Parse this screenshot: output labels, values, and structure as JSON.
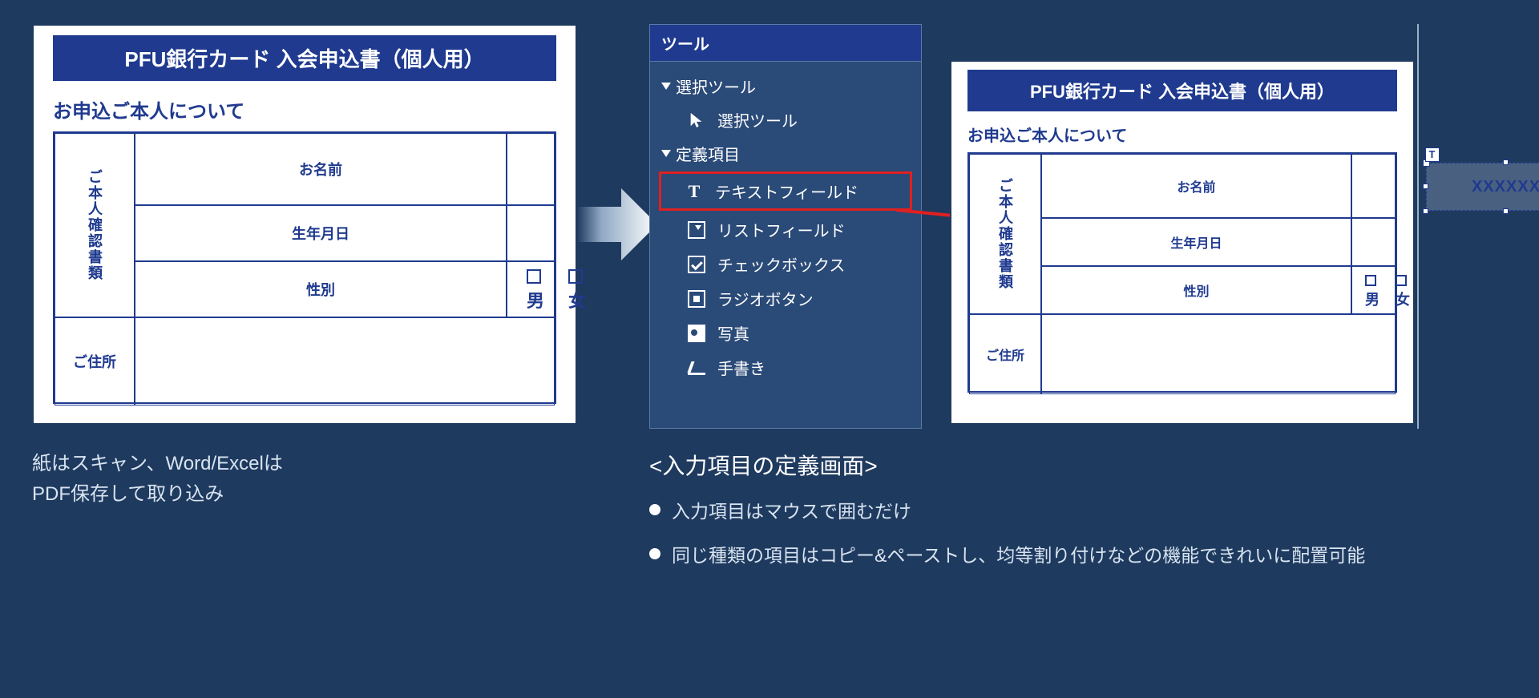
{
  "form": {
    "title": "PFU銀行カード 入会申込書（個人用）",
    "subhead": "お申込ご本人について",
    "labels": {
      "name": "お名前",
      "dob": "生年月日",
      "gender": "性別",
      "address": "ご住所",
      "docs": "ご本人確認書類"
    },
    "gender_options": {
      "male": "男",
      "female": "女"
    },
    "textfield_sample": "XXXXXX",
    "textfield_tag": "T"
  },
  "tools": {
    "header": "ツール",
    "group_select": "選択ツール",
    "item_select": "選択ツール",
    "group_defs": "定義項目",
    "items": {
      "text": "テキストフィールド",
      "list": "リストフィールド",
      "check": "チェックボックス",
      "radio": "ラジオボタン",
      "photo": "写真",
      "hand": "手書き"
    }
  },
  "captions": {
    "left_line1": "紙はスキャン、Word/Excelは",
    "left_line2": "PDF保存して取り込み",
    "right_heading": "<入力項目の定義画面>",
    "right_bullet1": "入力項目はマウスで囲むだけ",
    "right_bullet2": "同じ種類の項目はコピー&ペーストし、均等割り付けなどの機能できれいに配置可能"
  }
}
